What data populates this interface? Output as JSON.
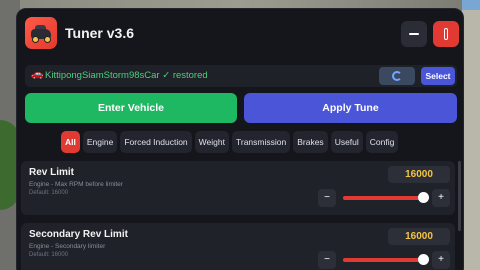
{
  "window": {
    "title": "Tuner v3.6",
    "accent": "#e03a32",
    "green": "#1fb862",
    "blue": "#4a55d8"
  },
  "config": {
    "car_icon": "car-icon",
    "status": "KittipongSiamStorm98sCar ✓ restored",
    "refresh_icon": "refresh-icon",
    "select_label": "Select"
  },
  "actions": {
    "enter_label": "Enter Vehicle",
    "apply_label": "Apply Tune"
  },
  "tabs": [
    "All",
    "Engine",
    "Forced Induction",
    "Weight",
    "Transmission",
    "Brakes",
    "Useful",
    "Config"
  ],
  "active_tab": "All",
  "settings": [
    {
      "title": "Rev Limit",
      "description": "Engine - Max RPM before limiter",
      "default": "Default: 16000",
      "value": "16000",
      "minus": "−",
      "plus": "+",
      "slider_fraction": 0.96
    },
    {
      "title": "Secondary Rev Limit",
      "description": "Engine - Secondary limiter",
      "default": "Default: 16000",
      "value": "16000",
      "minus": "−",
      "plus": "+",
      "slider_fraction": 0.96
    }
  ]
}
